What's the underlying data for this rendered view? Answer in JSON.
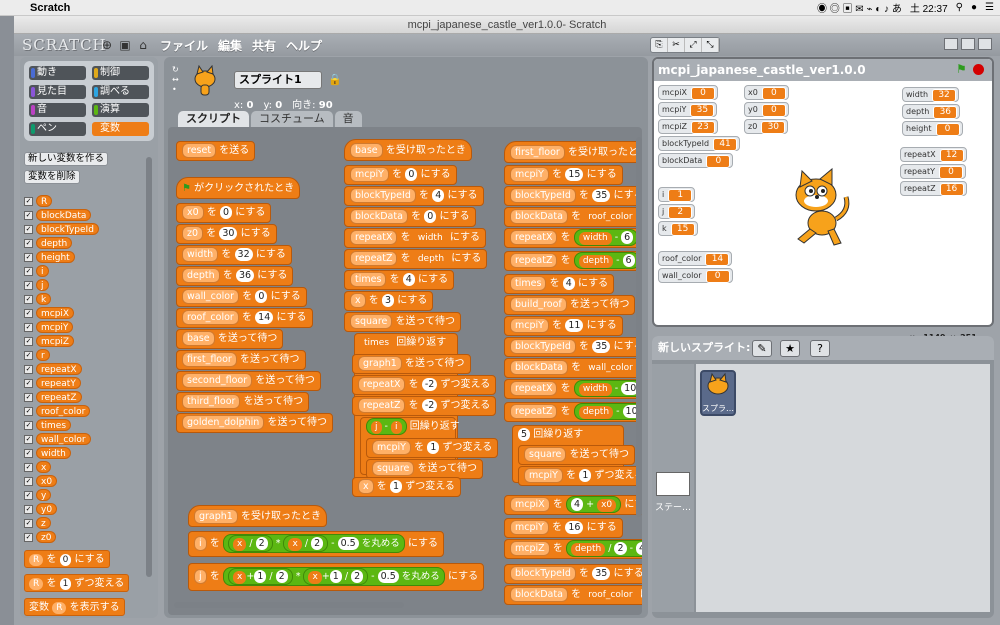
{
  "menubar": {
    "app": "Scratch",
    "time": "土 22:37"
  },
  "window": {
    "title": "mcpi_japanese_castle_ver1.0.0- Scratch"
  },
  "topbar": {
    "logo": "SCRATCH",
    "menus": [
      "ファイル",
      "編集",
      "共有",
      "ヘルプ"
    ]
  },
  "palette": {
    "categories": [
      {
        "label": "動き",
        "color": "#4a6cd4"
      },
      {
        "label": "制御",
        "color": "#e1a91a"
      },
      {
        "label": "見た目",
        "color": "#8a55d7"
      },
      {
        "label": "調べる",
        "color": "#2ca5e2"
      },
      {
        "label": "音",
        "color": "#bb42c3"
      },
      {
        "label": "演算",
        "color": "#5cb712"
      },
      {
        "label": "ペン",
        "color": "#0e9a6c"
      },
      {
        "label": "変数",
        "color": "#ee7d16"
      }
    ],
    "new_var": "新しい変数を作る",
    "del_var": "変数を削除",
    "vars": [
      "R",
      "blockData",
      "blockTypeId",
      "depth",
      "height",
      "i",
      "j",
      "k",
      "mcpiX",
      "mcpiY",
      "mcpiZ",
      "r",
      "repeatX",
      "repeatY",
      "repeatZ",
      "roof_color",
      "times",
      "wall_color",
      "width",
      "x",
      "x0",
      "y",
      "y0",
      "z",
      "z0"
    ],
    "b_set": "R",
    "b_set_val": "0",
    "b_set_txt": "にする",
    "b_chg": "R",
    "b_chg_val": "1",
    "b_chg_txt": "ずつ変える",
    "b_show_pre": "変数",
    "b_show": "R",
    "b_show_txt": "を表示する"
  },
  "sprite": {
    "name": "スプライト1",
    "x_label": "x:",
    "x": "0",
    "y_label": "y:",
    "y": "0",
    "dir_label": "向き:",
    "dir": "90"
  },
  "tabs": [
    "スクリプト",
    "コスチューム",
    "音"
  ],
  "scripts": {
    "send": "を送る",
    "sendwait": "を送って待つ",
    "set": "にする",
    "chg": "ずつ変える",
    "recv": "を受け取ったとき",
    "flag_hat": "がクリックされたとき",
    "repeat": "回繰り返す",
    "wo": "を",
    "round": "を丸める",
    "reset": "reset",
    "base": "base",
    "square": "square",
    "graph1": "graph1",
    "first_floor": "first_floor",
    "second_floor": "second_floor",
    "third_floor": "third_floor",
    "golden_dolphin": "golden_dolphin",
    "build_roof": "build_roof",
    "times_r": "times",
    "x0": "x0",
    "z0": "z0",
    "width": "width",
    "depth": "depth",
    "wall_color": "wall_color",
    "roof_color": "roof_color",
    "mcpiY": "mcpiY",
    "mcpiX": "mcpiX",
    "mcpiZ": "mcpiZ",
    "blockTypeId": "blockTypeId",
    "blockData": "blockData",
    "repeatX": "repeatX",
    "repeatZ": "repeatZ",
    "times": "times",
    "x": "x",
    "i": "i",
    "j": "j",
    "v0": "0",
    "v30": "30",
    "v32": "32",
    "v36": "36",
    "v14": "14",
    "v4": "4",
    "v3": "3",
    "vm2": "-2",
    "v1": "1",
    "v15": "15",
    "v6": "6",
    "v10": "10",
    "v11": "11",
    "v35": "35",
    "v5": "5",
    "v16": "16",
    "v2": "2",
    "v05": "0.5",
    "v4b": "4",
    "vminus": "-",
    "slash": "/",
    "star": "*",
    "plus": "+"
  },
  "stage": {
    "title": "mcpi_japanese_castle_ver1.0.0",
    "monitors": [
      {
        "n": "mcpiX",
        "v": "0"
      },
      {
        "n": "mcpiY",
        "v": "35"
      },
      {
        "n": "mcpiZ",
        "v": "23"
      },
      {
        "n": "blockTypeId",
        "v": "41"
      },
      {
        "n": "blockData",
        "v": "0"
      },
      {
        "n": "x0",
        "v": "0"
      },
      {
        "n": "y0",
        "v": "0"
      },
      {
        "n": "z0",
        "v": "30"
      },
      {
        "n": "width",
        "v": "32"
      },
      {
        "n": "depth",
        "v": "36"
      },
      {
        "n": "height",
        "v": "0"
      },
      {
        "n": "repeatX",
        "v": "12"
      },
      {
        "n": "repeatY",
        "v": "0"
      },
      {
        "n": "repeatZ",
        "v": "16"
      },
      {
        "n": "i",
        "v": "1"
      },
      {
        "n": "j",
        "v": "2"
      },
      {
        "n": "k",
        "v": "15"
      },
      {
        "n": "roof_color",
        "v": "14"
      },
      {
        "n": "wall_color",
        "v": "0"
      }
    ]
  },
  "mouse": {
    "x_label": "x:",
    "x": "-1149",
    "y_label": "y:",
    "y": "251"
  },
  "sprites": {
    "label": "新しいスプライト:",
    "thumb": "スプラ…",
    "stage": "ステー…"
  }
}
